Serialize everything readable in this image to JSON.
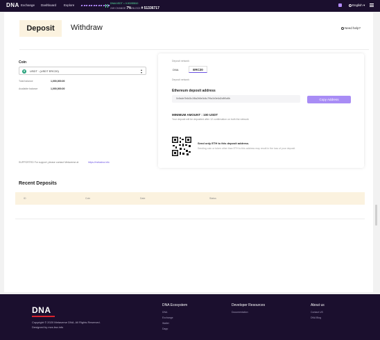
{
  "header": {
    "logo": "DNA",
    "nav": [
      "Exchange",
      "Dashboard",
      "Explore"
    ],
    "ticker": {
      "pair": "DNA/USDT = 0.00283810",
      "change_label": "24H CHANGE",
      "price": "7%",
      "block_label": "BLOCK",
      "block": "# 51336717"
    },
    "language": "English"
  },
  "tabs": {
    "deposit": "Deposit",
    "withdraw": "Withdraw"
  },
  "help": "Need help?",
  "coin": {
    "label": "Coin",
    "selected": "USDT · (USDT ERC20)",
    "total_balance_label": "Total balance",
    "total_balance": "1,000,000.00",
    "available_label": "Available balance",
    "available": "1,000,000.00",
    "support_text": "SUPPORTED For support, please contact Metaverse at",
    "support_link": "https://metadna.info"
  },
  "deposit_card": {
    "network_label": "Deposit network",
    "networks": [
      "DNA",
      "ERC20"
    ],
    "network_selected_label": "Deposit network",
    "address_title": "Ethereum deposit address",
    "address": "0x9a4e7b6d3c1f8a2b5e0d4c7f9a1b3e6d2c8f0a5b",
    "copy_label": "Copy Address",
    "min_amount": "MINIMUM AMOUNT : 100 USDT",
    "min_note": "Your deposit will be deposited after 12 confirmation on both the network",
    "send_title": "Send only ETH to this deposit address.",
    "send_note": "Sending coin or token other than ETH to this address may result in the loss of your deposit."
  },
  "recent": {
    "title": "Recent Deposits",
    "columns": [
      "ID",
      "Coin",
      "Date",
      "Status"
    ]
  },
  "footer": {
    "logo": "DNA",
    "copyright": "Copyright © 2020 Metaverse DNA. All Rights Reserved.",
    "designed": "Designed by mvs.bsv.info",
    "sections": [
      {
        "title": "DNA Ecosystem",
        "links": [
          "DNA",
          "Exchange",
          "Wallet",
          "Dapp"
        ]
      },
      {
        "title": "Developer Resources",
        "links": [
          "Documentation"
        ]
      },
      {
        "title": "About us",
        "links": [
          "Contact US",
          "DNA Blog"
        ]
      }
    ]
  },
  "colors": {
    "nav_bg": "#1b0f2e",
    "accent": "#a88cf5",
    "tab_bg": "#fbf2df",
    "tether": "#26a17b"
  }
}
